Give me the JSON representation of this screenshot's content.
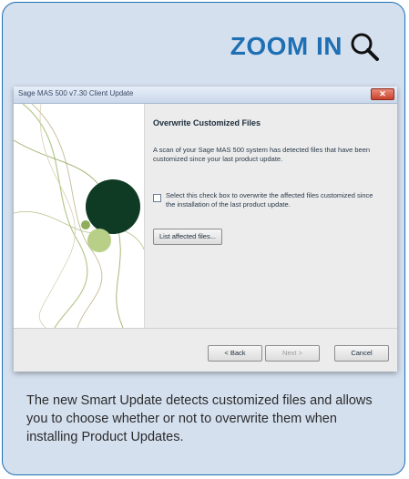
{
  "zoom": {
    "label": "ZOOM IN",
    "icon": "magnifier-icon"
  },
  "dialog": {
    "title": "Sage MAS 500 v7.30 Client Update",
    "close_glyph": "✕",
    "heading": "Overwrite Customized Files",
    "description": "A scan of your Sage MAS 500 system has detected files that have been customized since your last product update.",
    "checkbox_label": "Select this check box to overwrite the affected files customized since the installation of the last product update.",
    "checkbox_checked": false,
    "list_button": "List affected files...",
    "back_button": "< Back",
    "next_button": "Next >",
    "cancel_button": "Cancel"
  },
  "caption": "The new Smart Update detects customized files and allows you to choose whether or not to overwrite them when installing Product Updates.",
  "colors": {
    "card_background": "#d5e0ef",
    "card_border": "#1f6fb3",
    "accent": "#1f6fb3",
    "graphic_dark_green": "#0f3b25",
    "graphic_light_green": "#b7cf86"
  }
}
